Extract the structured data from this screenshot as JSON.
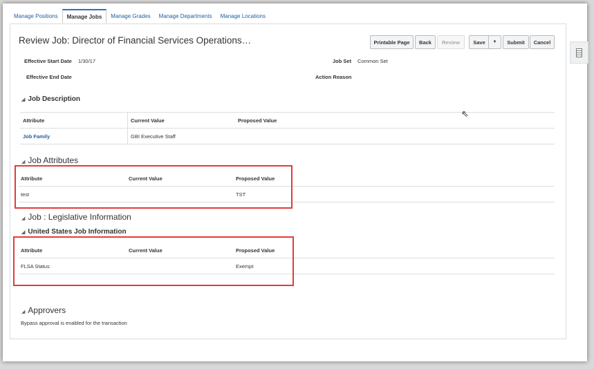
{
  "tabs": [
    "Manage Positions",
    "Manage Jobs",
    "Manage Grades",
    "Manage Departments",
    "Manage Locations"
  ],
  "page_title": "Review Job: Director of Financial Services Operations…",
  "buttons": {
    "printable": "Printable Page",
    "back": "Back",
    "review": "Review",
    "save": "Save",
    "save_menu": "▼",
    "submit": "Submit",
    "cancel": "Cancel"
  },
  "fields": {
    "start_label": "Effective Start Date",
    "start_value": "1/30/17",
    "end_label": "Effective End Date",
    "jobset_label": "Job Set",
    "jobset_value": "Common Set",
    "reason_label": "Action Reason"
  },
  "job_description": {
    "title": "Job Description",
    "headers": [
      "Attribute",
      "Current Value",
      "Proposed Value"
    ],
    "rows": [
      [
        "Job Family",
        "GBI Executive Staff",
        ""
      ]
    ]
  },
  "job_attributes": {
    "title": "Job Attributes",
    "headers": [
      "Attribute",
      "Current Value",
      "Proposed Value"
    ],
    "rows": [
      [
        "test",
        "",
        "TST"
      ]
    ]
  },
  "legislative": {
    "title": "Job : Legislative Information",
    "sub_title": "United States Job Information",
    "headers": [
      "Attribute",
      "Current Value",
      "Proposed Value"
    ],
    "rows": [
      [
        "FLSA Status",
        "",
        "Exempt"
      ]
    ]
  },
  "approvers": {
    "title": "Approvers",
    "text": "Bypass approval is enabled for the transaction"
  },
  "colors": {
    "highlight": "#e23b3b",
    "tab_accent": "#2d6ec0"
  }
}
